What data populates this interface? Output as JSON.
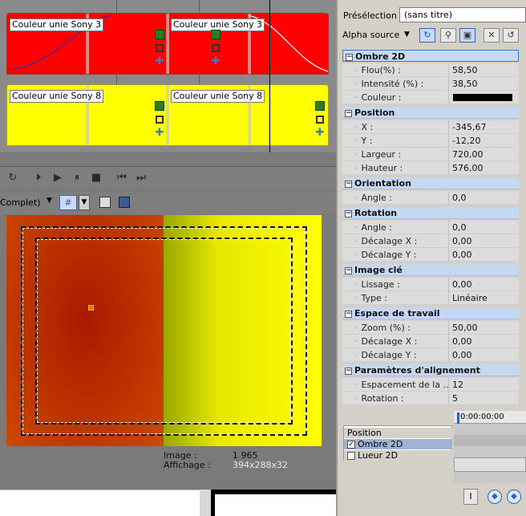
{
  "timeline": {
    "tracks": [
      {
        "color": "#ff0000",
        "events": [
          {
            "label": "Couleur unie Sony 3"
          },
          {
            "label": "Couleur unie Sony 3"
          }
        ]
      },
      {
        "color": "#ffff00",
        "events": [
          {
            "label": "Couleur unie Sony 8"
          },
          {
            "label": "Couleur unie Sony 8"
          }
        ]
      }
    ],
    "event_icons": [
      "film-icon",
      "crop-icon",
      "pan-icon"
    ]
  },
  "transport": {
    "buttons": [
      "loop-icon",
      "play-from-start-icon",
      "play-icon",
      "pause-icon",
      "stop-icon",
      "prev-frame-icon",
      "next-frame-icon"
    ]
  },
  "preview_toolbar": {
    "quality_label": "Complet)"
  },
  "preview_info": {
    "image_label": "Image :",
    "image_value": "1 965",
    "display_label": "Affichage :",
    "display_value": "394x288x32"
  },
  "right_panel": {
    "preset_label": "Présélection :",
    "preset_value": "(sans titre)",
    "alpha_label": "Alpha source"
  },
  "properties": [
    {
      "section": "Ombre 2D",
      "rows": [
        {
          "label": "Flou(%) :",
          "value": "58,50"
        },
        {
          "label": "Intensité (%) :",
          "value": "38,50"
        },
        {
          "label": "Couleur :",
          "value": ""
        }
      ]
    },
    {
      "section": "Position",
      "rows": [
        {
          "label": "X :",
          "value": "-345,67"
        },
        {
          "label": "Y :",
          "value": "-12,20"
        },
        {
          "label": "Largeur :",
          "value": "720,00"
        },
        {
          "label": "Hauteur :",
          "value": "576,00"
        }
      ]
    },
    {
      "section": "Orientation",
      "rows": [
        {
          "label": "Angle :",
          "value": "0,0"
        }
      ]
    },
    {
      "section": "Rotation",
      "rows": [
        {
          "label": "Angle :",
          "value": "0,0"
        },
        {
          "label": "Décalage X :",
          "value": "0,00"
        },
        {
          "label": "Décalage Y :",
          "value": "0,00"
        }
      ]
    },
    {
      "section": "Image clé",
      "rows": [
        {
          "label": "Lissage :",
          "value": "0,00"
        },
        {
          "label": "Type :",
          "value": "Linéaire"
        }
      ]
    },
    {
      "section": "Espace de travail",
      "rows": [
        {
          "label": "Zoom (%) :",
          "value": "50,00"
        },
        {
          "label": "Décalage X :",
          "value": "0,00"
        },
        {
          "label": "Décalage Y :",
          "value": "0,00"
        }
      ]
    },
    {
      "section": "Paramètres d'alignement",
      "rows": [
        {
          "label": "Espacement de la ...",
          "value": "12"
        },
        {
          "label": "Rotation :",
          "value": "5"
        }
      ]
    }
  ],
  "shadow_color": "#000000",
  "keyframes": {
    "items": [
      {
        "label": "Position",
        "checked": null
      },
      {
        "label": "Ombre 2D",
        "checked": true
      },
      {
        "label": "Lueur 2D",
        "checked": false
      }
    ],
    "timecode": "0:00:00:00"
  }
}
